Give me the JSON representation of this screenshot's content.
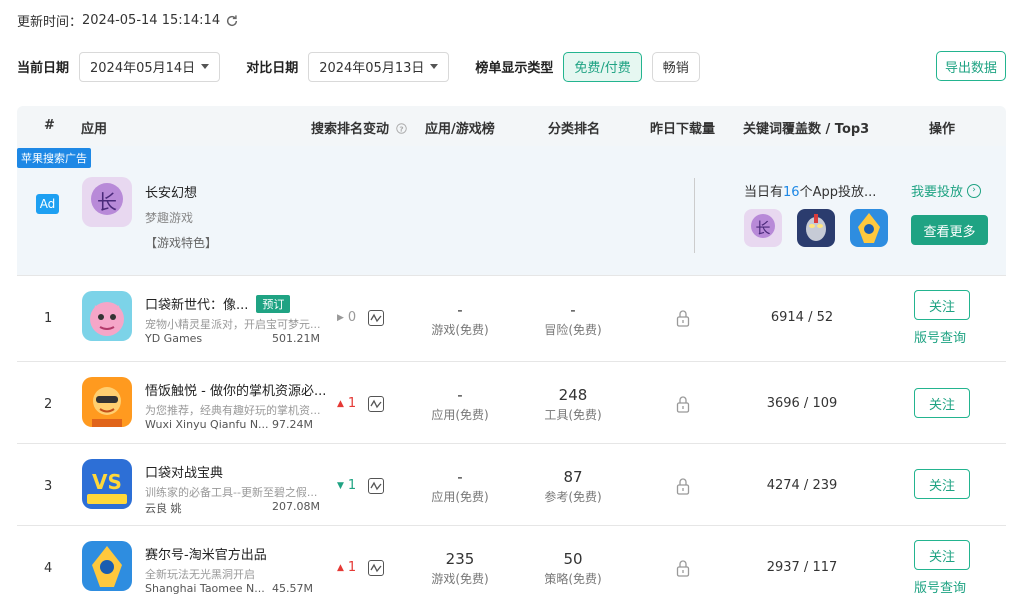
{
  "header": {
    "update_label": "更新时间：",
    "update_time": "2024-05-14 15:14:14"
  },
  "filters": {
    "current_date_label": "当前日期",
    "current_date_value": "2024年05月14日",
    "compare_date_label": "对比日期",
    "compare_date_value": "2024年05月13日",
    "list_type_label": "榜单显示类型",
    "type_free_paid": "免费/付费",
    "type_grossing": "畅销",
    "export_label": "导出数据"
  },
  "columns": {
    "rank": "#",
    "app": "应用",
    "search_rank_change": "搜索排名变动",
    "app_game_chart": "应用/游戏榜",
    "category_rank": "分类排名",
    "yesterday_downloads": "昨日下载量",
    "keyword_coverage": "关键词覆盖数 / Top3",
    "actions": "操作"
  },
  "ad": {
    "tag": "苹果搜索广告",
    "badge": "Ad",
    "title": "长安幻想",
    "developer": "梦趣游戏",
    "feature": "【游戏特色】",
    "count_prefix": "当日有",
    "count_number": "16",
    "count_suffix": "个App投放...",
    "invest_link": "我要投放",
    "more_button": "查看更多",
    "icon_names": [
      "changan-icon",
      "ultraman-icon",
      "seer-icon"
    ]
  },
  "rows": [
    {
      "rank": "1",
      "title": "口袋新世代：像...",
      "badge": "预订",
      "desc": "宠物小精灵星派对，开启宝可梦元...",
      "developer": "YD Games",
      "downloads": "501.21M",
      "trend_dir": "flat",
      "trend_value": "0",
      "chart_value": "-",
      "chart_label": "游戏(免费)",
      "category_value": "-",
      "category_label": "冒险(免费)",
      "keywords": "6914 / 52",
      "follow": "关注",
      "version": "版号查询"
    },
    {
      "rank": "2",
      "title": "悟饭触悦 - 做你的掌机资源必...",
      "badge": "",
      "desc": "为您推荐，经典有趣好玩的掌机资...",
      "developer": "Wuxi Xinyu Qianfu N...",
      "downloads": "97.24M",
      "trend_dir": "up",
      "trend_value": "1",
      "chart_value": "-",
      "chart_label": "应用(免费)",
      "category_value": "248",
      "category_label": "工具(免费)",
      "keywords": "3696 / 109",
      "follow": "关注",
      "version": ""
    },
    {
      "rank": "3",
      "title": "口袋对战宝典",
      "badge": "",
      "desc": "训练家的必备工具--更新至碧之假...",
      "developer": "云良 姚",
      "downloads": "207.08M",
      "trend_dir": "down",
      "trend_value": "1",
      "chart_value": "-",
      "chart_label": "应用(免费)",
      "category_value": "87",
      "category_label": "参考(免费)",
      "keywords": "4274 / 239",
      "follow": "关注",
      "version": ""
    },
    {
      "rank": "4",
      "title": "赛尔号-淘米官方出品",
      "badge": "",
      "desc": "全新玩法无光黑洞开启",
      "developer": "Shanghai Taomee N...",
      "downloads": "45.57M",
      "trend_dir": "up",
      "trend_value": "1",
      "chart_value": "235",
      "chart_label": "游戏(免费)",
      "category_value": "50",
      "category_label": "策略(免费)",
      "keywords": "2937 / 117",
      "follow": "关注",
      "version": "版号查询"
    }
  ]
}
